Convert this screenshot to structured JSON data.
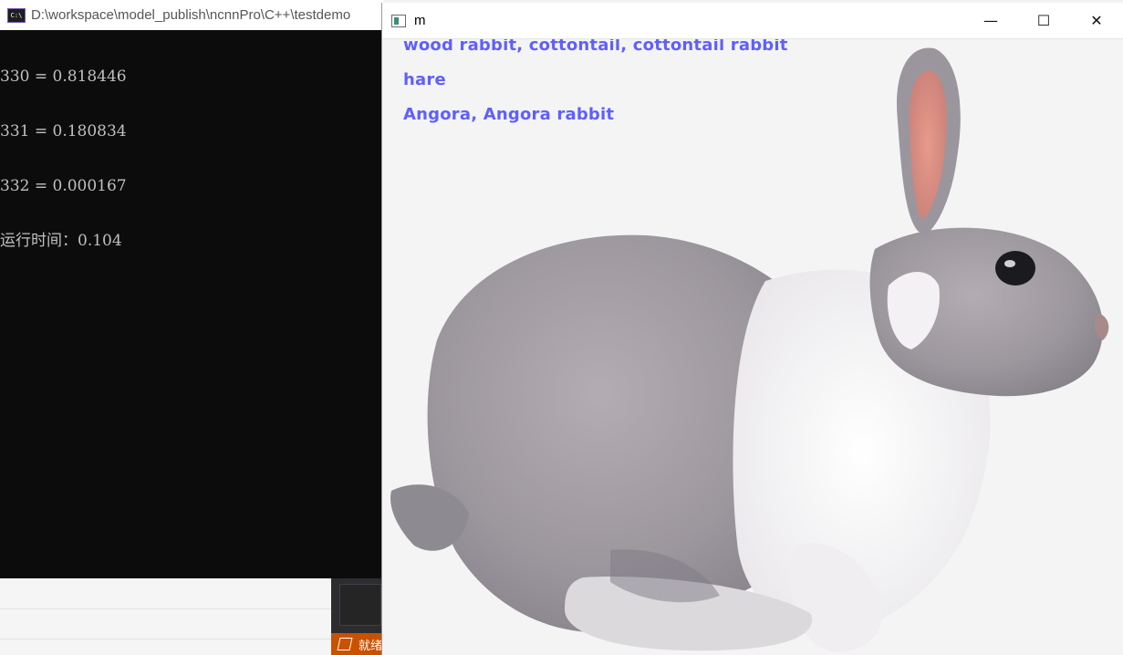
{
  "console": {
    "title": "D:\\workspace\\model_publish\\ncnnPro\\C++\\testdemo",
    "icon_text": "C:\\",
    "lines": [
      "330 = 0.818446",
      "331 = 0.180834",
      "332 = 0.000167",
      "运行时间：0.104"
    ]
  },
  "ide": {
    "status_text": "就绪"
  },
  "image_window": {
    "title": "m",
    "minimize": "—",
    "maximize": "☐",
    "close": "✕",
    "predictions": [
      "wood rabbit, cottontail, cottontail rabbit",
      "hare",
      "Angora, Angora rabbit"
    ]
  },
  "colors": {
    "label_color": "#5f5fff",
    "console_bg": "#0c0c0c",
    "status_orange": "#ca5100"
  }
}
